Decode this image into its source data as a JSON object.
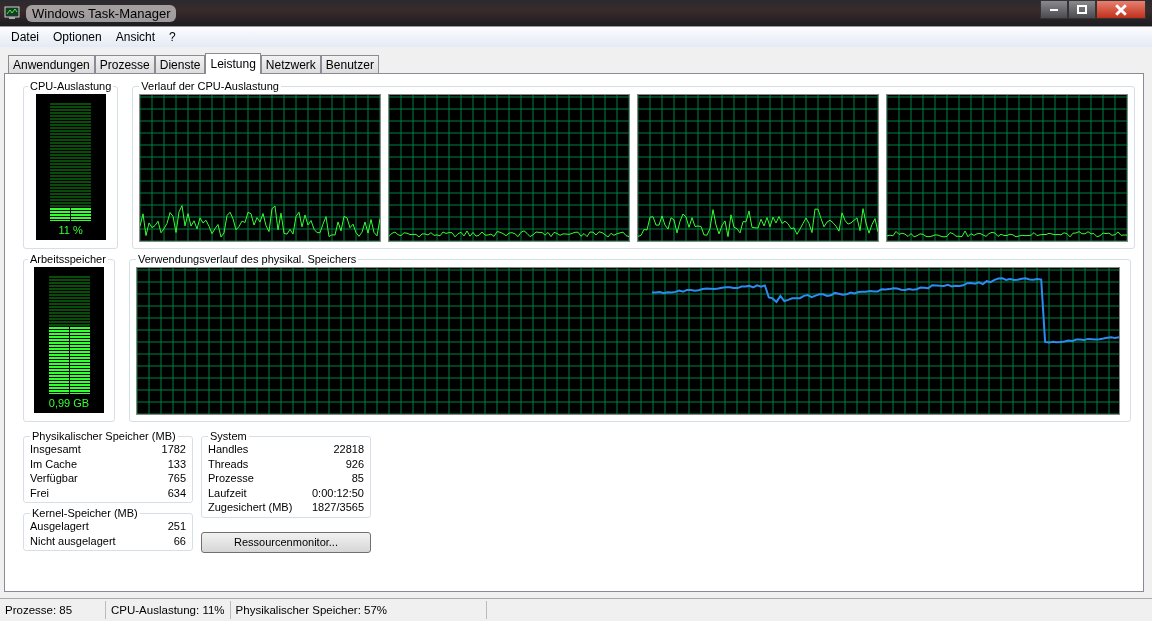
{
  "window": {
    "title": "Windows Task-Manager"
  },
  "menu": [
    "Datei",
    "Optionen",
    "Ansicht",
    "?"
  ],
  "tabs": [
    {
      "label": "Anwendungen",
      "selected": false
    },
    {
      "label": "Prozesse",
      "selected": false
    },
    {
      "label": "Dienste",
      "selected": false
    },
    {
      "label": "Leistung",
      "selected": true
    },
    {
      "label": "Netzwerk",
      "selected": false
    },
    {
      "label": "Benutzer",
      "selected": false
    }
  ],
  "cpu_meter": {
    "title": "CPU-Auslastung",
    "level": 0.11,
    "reading": "11 %"
  },
  "cpu_history": {
    "title": "Verlauf der CPU-Auslastung"
  },
  "memory_meter": {
    "title": "Arbeitsspeicher",
    "level": 0.57,
    "reading": "0,99 GB"
  },
  "memory_history": {
    "title": "Verwendungsverlauf des physikal. Speichers"
  },
  "physical_memory": {
    "title": "Physikalischer Speicher (MB)",
    "rows": [
      {
        "label": "Insgesamt",
        "value": "1782"
      },
      {
        "label": "Im Cache",
        "value": "133"
      },
      {
        "label": "Verfügbar",
        "value": "765"
      },
      {
        "label": "Frei",
        "value": "634"
      }
    ]
  },
  "kernel_memory": {
    "title": "Kernel-Speicher (MB)",
    "rows": [
      {
        "label": "Ausgelagert",
        "value": "251"
      },
      {
        "label": "Nicht ausgelagert",
        "value": "66"
      }
    ]
  },
  "system": {
    "title": "System",
    "rows": [
      {
        "label": "Handles",
        "value": "22818"
      },
      {
        "label": "Threads",
        "value": "926"
      },
      {
        "label": "Prozesse",
        "value": "85"
      },
      {
        "label": "Laufzeit",
        "value": "0:00:12:50"
      },
      {
        "label": "Zugesichert (MB)",
        "value": "1827/3565"
      }
    ]
  },
  "resource_button": "Ressourcenmonitor...",
  "status_bar": [
    "Prozesse: 85",
    "CPU-Auslastung: 11%",
    "Physikalischer Speicher: 57%"
  ]
}
